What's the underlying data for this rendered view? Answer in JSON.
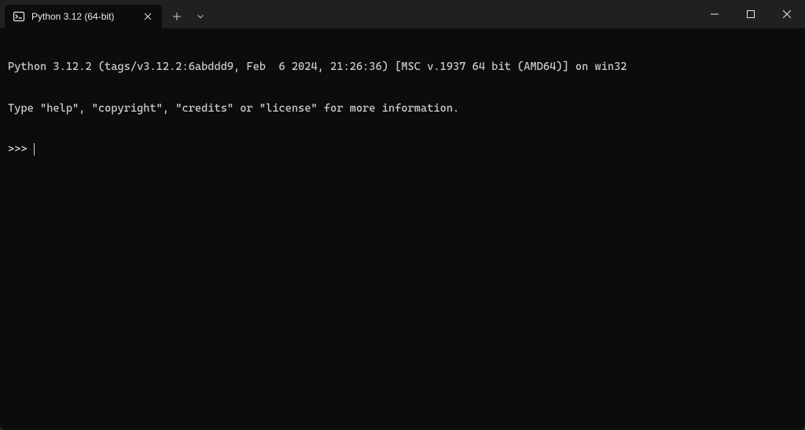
{
  "tab": {
    "title": "Python 3.12 (64-bit)",
    "icon": "terminal-icon"
  },
  "terminal": {
    "line1": "Python 3.12.2 (tags/v3.12.2:6abddd9, Feb  6 2024, 21:26:36) [MSC v.1937 64 bit (AMD64)] on win32",
    "line2": "Type \"help\", \"copyright\", \"credits\" or \"license\" for more information.",
    "prompt": ">>> "
  }
}
